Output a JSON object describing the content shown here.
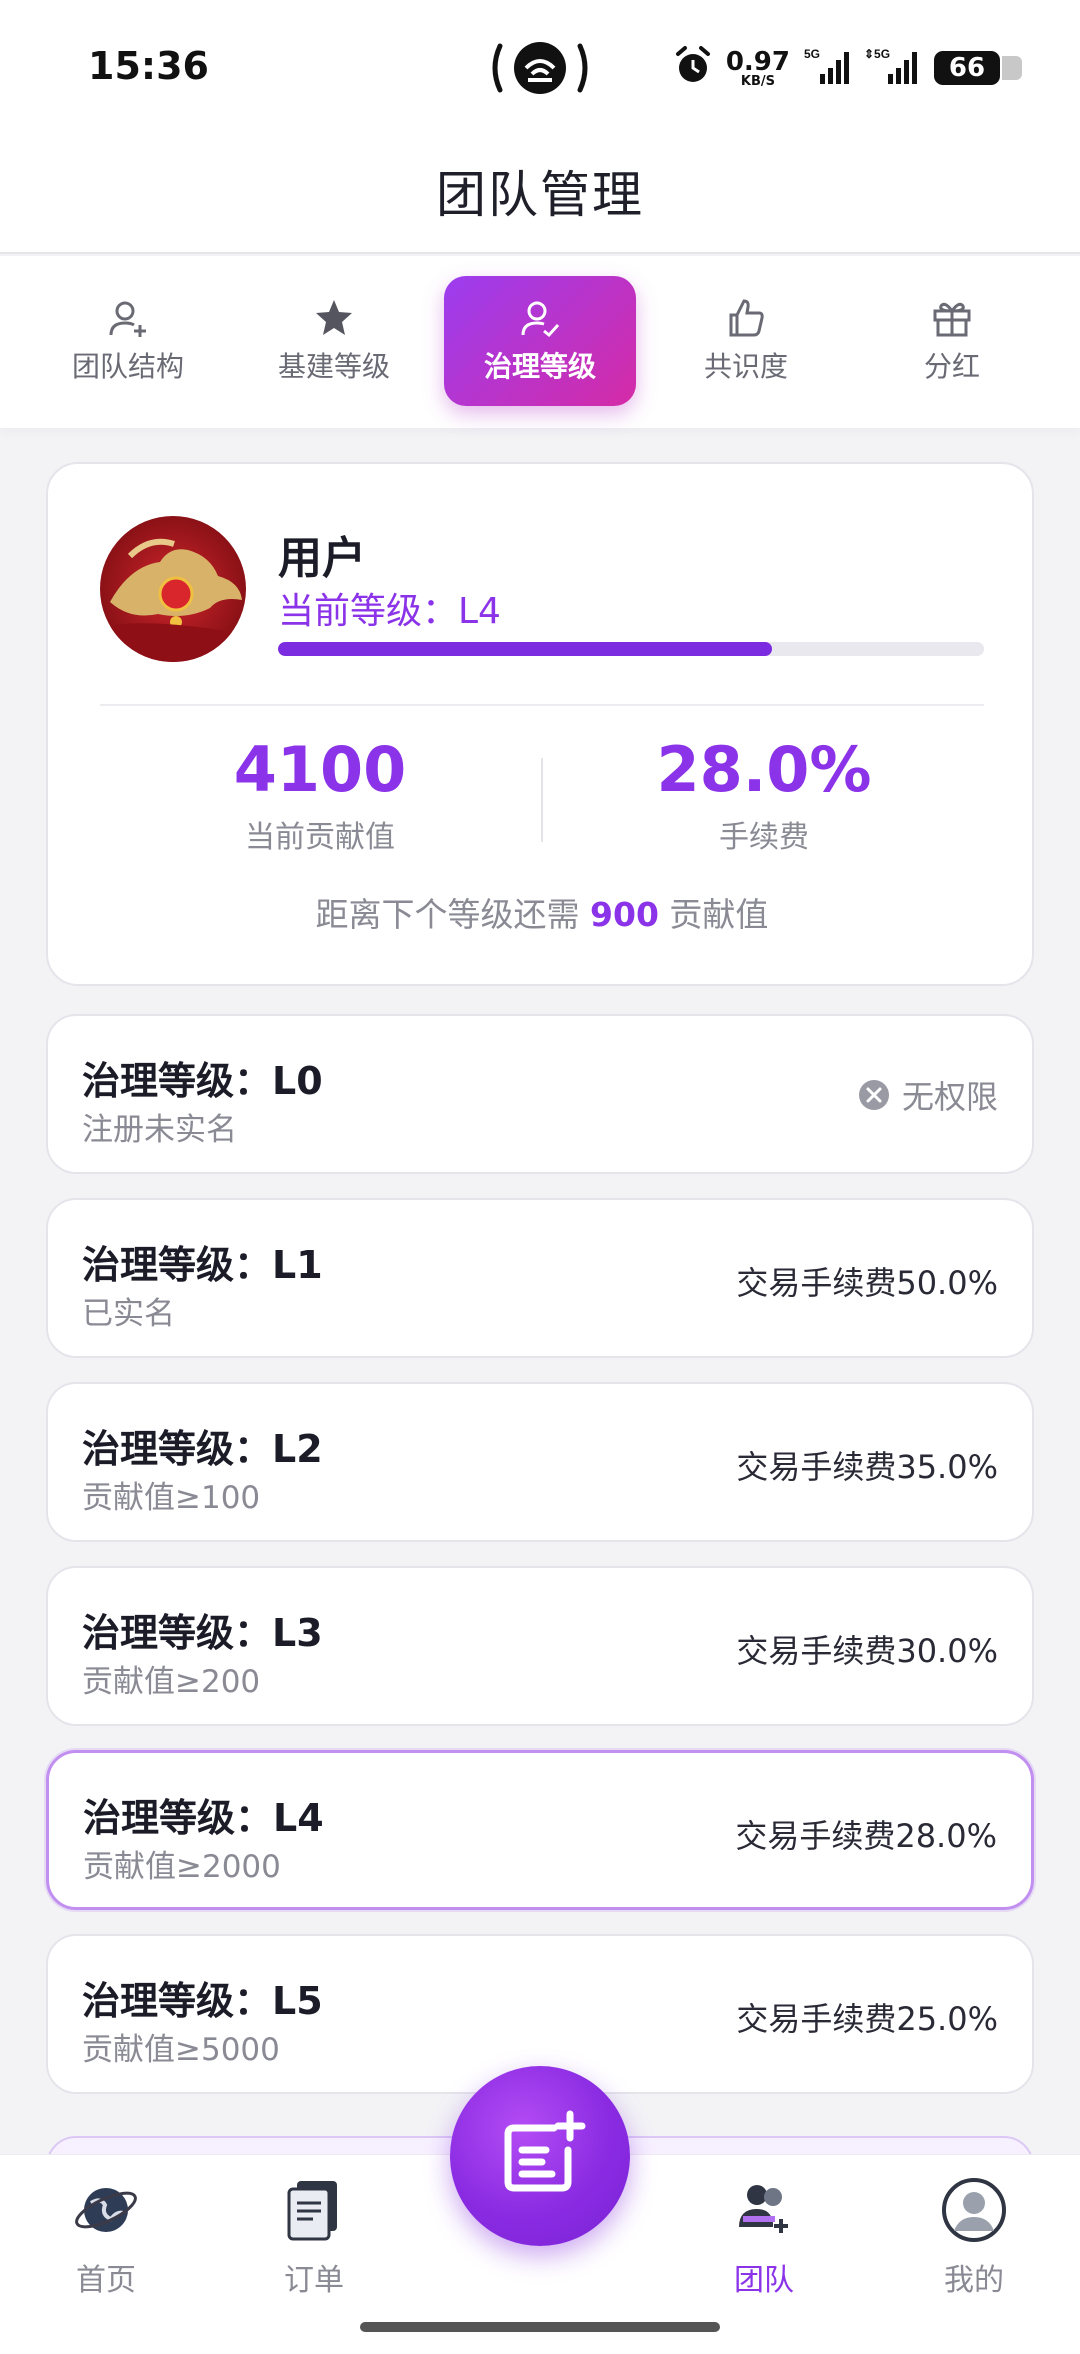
{
  "status_bar": {
    "time": "15:36",
    "net_speed": "0.97",
    "net_unit": "KB/S",
    "battery": "66",
    "icons": [
      "hotspot-icon",
      "alarm-icon",
      "signal-5g-icon",
      "signal-5g-icon",
      "battery-icon"
    ]
  },
  "header": {
    "title": "团队管理"
  },
  "tabs": [
    {
      "label": "团队结构",
      "icon": "user-add-icon",
      "active": false
    },
    {
      "label": "基建等级",
      "icon": "star-icon",
      "active": false
    },
    {
      "label": "治理等级",
      "icon": "user-check-icon",
      "active": true
    },
    {
      "label": "共识度",
      "icon": "thumbs-up-icon",
      "active": false
    },
    {
      "label": "分红",
      "icon": "gift-icon",
      "active": false
    }
  ],
  "profile": {
    "name": "用户",
    "current_level": "当前等级：L4",
    "progress_fraction": 0.7,
    "contribution_value": "4100",
    "contribution_label": "当前贡献值",
    "fee_value": "28.0%",
    "fee_label": "手续费",
    "next_prefix": "距离下个等级还需 ",
    "next_amount": "900",
    "next_suffix": " 贡献值"
  },
  "levels": [
    {
      "title": "治理等级：L0",
      "requirement": "注册未实名",
      "fee": "",
      "no_permission": "无权限"
    },
    {
      "title": "治理等级：L1",
      "requirement": "已实名",
      "fee": "交易手续费50.0%"
    },
    {
      "title": "治理等级：L2",
      "requirement": "贡献值≥100",
      "fee": "交易手续费35.0%"
    },
    {
      "title": "治理等级：L3",
      "requirement": "贡献值≥200",
      "fee": "交易手续费30.0%"
    },
    {
      "title": "治理等级：L4",
      "requirement": "贡献值≥2000",
      "fee": "交易手续费28.0%",
      "current": true
    },
    {
      "title": "治理等级：L5",
      "requirement": "贡献值≥5000",
      "fee": "交易手续费25.0%"
    }
  ],
  "bottom_nav": [
    {
      "label": "首页",
      "icon": "globe-icon",
      "active": false
    },
    {
      "label": "订单",
      "icon": "orders-icon",
      "active": false
    },
    {
      "label": "团队",
      "icon": "team-icon",
      "active": true
    },
    {
      "label": "我的",
      "icon": "profile-icon",
      "active": false
    }
  ],
  "colors": {
    "accent": "#8b33e8",
    "accent_pink": "#d52ba6",
    "muted": "#8a8a94"
  }
}
